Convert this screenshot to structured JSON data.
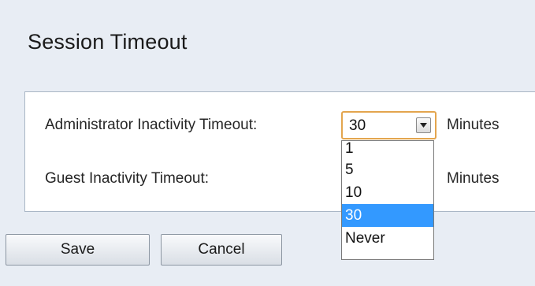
{
  "page": {
    "title": "Session Timeout"
  },
  "admin_timeout": {
    "label": "Administrator Inactivity Timeout:",
    "value": "30",
    "unit": "Minutes",
    "options": [
      "1",
      "5",
      "10",
      "30",
      "Never"
    ],
    "highlighted_option": "30"
  },
  "guest_timeout": {
    "label": "Guest Inactivity Timeout:",
    "unit": "Minutes"
  },
  "buttons": {
    "save": "Save",
    "cancel": "Cancel"
  },
  "colors": {
    "page_background": "#e8edf4",
    "focus_border": "#e3a54e",
    "selection": "#3399ff"
  }
}
